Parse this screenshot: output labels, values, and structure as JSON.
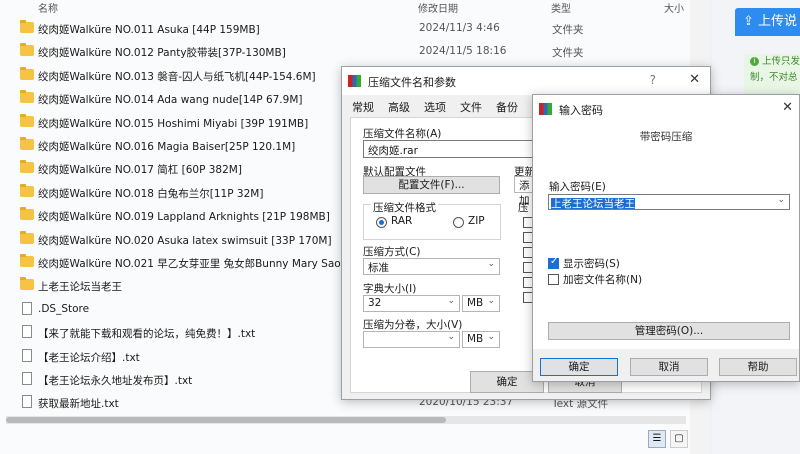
{
  "explorer": {
    "columns": {
      "name": "名称",
      "date": "修改日期",
      "type": "类型",
      "size": "大小"
    },
    "rows": [
      {
        "kind": "folder",
        "name": "绞肉姬Walküre NO.011 Asuka [44P 159MB]",
        "date": "2024/11/3 4:46",
        "type": "文件夹"
      },
      {
        "kind": "folder",
        "name": "绞肉姬Walküre NO.012 Panty胶带装[37P-130MB]",
        "date": "2024/11/5 18:16",
        "type": "文件夹"
      },
      {
        "kind": "folder",
        "name": "绞肉姬Walküre NO.013 褩音-囚人与纸飞机[44P-154.6M]",
        "date": "",
        "type": ""
      },
      {
        "kind": "folder",
        "name": "绞肉姬Walküre NO.014 Ada wang nude[14P 67.9M]",
        "date": "",
        "type": ""
      },
      {
        "kind": "folder",
        "name": "绞肉姬Walküre NO.015 Hoshimi Miyabi [39P 191MB]",
        "date": "",
        "type": ""
      },
      {
        "kind": "folder",
        "name": "绞肉姬Walküre NO.016 Magia Baiser[25P 120.1M]",
        "date": "",
        "type": ""
      },
      {
        "kind": "folder",
        "name": "绞肉姬Walküre NO.017 简杠 [60P 382M]",
        "date": "",
        "type": ""
      },
      {
        "kind": "folder",
        "name": "绞肉姬Walküre NO.018 白兔布兰尔[11P 32M]",
        "date": "",
        "type": ""
      },
      {
        "kind": "folder",
        "name": "绞肉姬Walküre NO.019 Lappland Arknights [21P 198MB]",
        "date": "",
        "type": ""
      },
      {
        "kind": "folder",
        "name": "绞肉姬Walküre NO.020 Asuka latex swimsuit [33P 170M]",
        "date": "",
        "type": ""
      },
      {
        "kind": "folder",
        "name": "绞肉姬Walküre NO.021 早乙女芽亚里 兔女郎Bunny Mary Saotome",
        "date": "",
        "type": ""
      },
      {
        "kind": "folder",
        "name": "上老王论坛当老王",
        "date": "",
        "type": ""
      },
      {
        "kind": "file",
        "name": ".DS_Store",
        "date": "",
        "type": ""
      },
      {
        "kind": "file",
        "name": "【来了就能下载和观看的论坛，纯免费！】.txt",
        "date": "",
        "type": ""
      },
      {
        "kind": "file",
        "name": "【老王论坛介绍】.txt",
        "date": "",
        "type": ""
      },
      {
        "kind": "file",
        "name": "【老王论坛永久地址发布页】.txt",
        "date": "",
        "type": ""
      },
      {
        "kind": "file",
        "name": "获取最新地址.txt",
        "date": "2020/10/15 23:37",
        "type": "Text 源文件"
      }
    ]
  },
  "upload_panel": {
    "title": "上传说",
    "note_line1": "上传只发",
    "note_line2": "制，不对总"
  },
  "rar_dialog": {
    "title": "压缩文件名和参数",
    "help": "?",
    "close": "✕",
    "tabs": [
      "常规",
      "高级",
      "选项",
      "文件",
      "备份"
    ],
    "archive_name_label": "压缩文件名称(A)",
    "archive_name_value": "绞肉姬.rar",
    "default_profile_label": "默认配置文件",
    "profile_button": "配置文件(F)...",
    "update_label": "更新",
    "update_value": "添加",
    "format_group": "压缩文件格式",
    "format_rar": "RAR",
    "format_zip": "ZIP",
    "options_group": "压",
    "method_label": "压缩方式(C)",
    "method_value": "标准",
    "dict_label": "字典大小(I)",
    "dict_value": "32",
    "dict_unit": "MB",
    "split_label": "压缩为分卷，大小(V)",
    "split_value": "",
    "split_unit": "MB",
    "ok_button": "确定",
    "cancel_button": "取消"
  },
  "password_dialog": {
    "title": "输入密码",
    "close": "✕",
    "subtitle": "带密码压缩",
    "password_label": "输入密码(E)",
    "password_value": "上老王论坛当老王",
    "show_password_label": "显示密码(S)",
    "show_password_checked": true,
    "encrypt_names_label": "加密文件名称(N)",
    "encrypt_names_checked": false,
    "manage_button": "管理密码(O)...",
    "ok_button": "确定",
    "cancel_button": "取消",
    "help_button": "帮助"
  }
}
